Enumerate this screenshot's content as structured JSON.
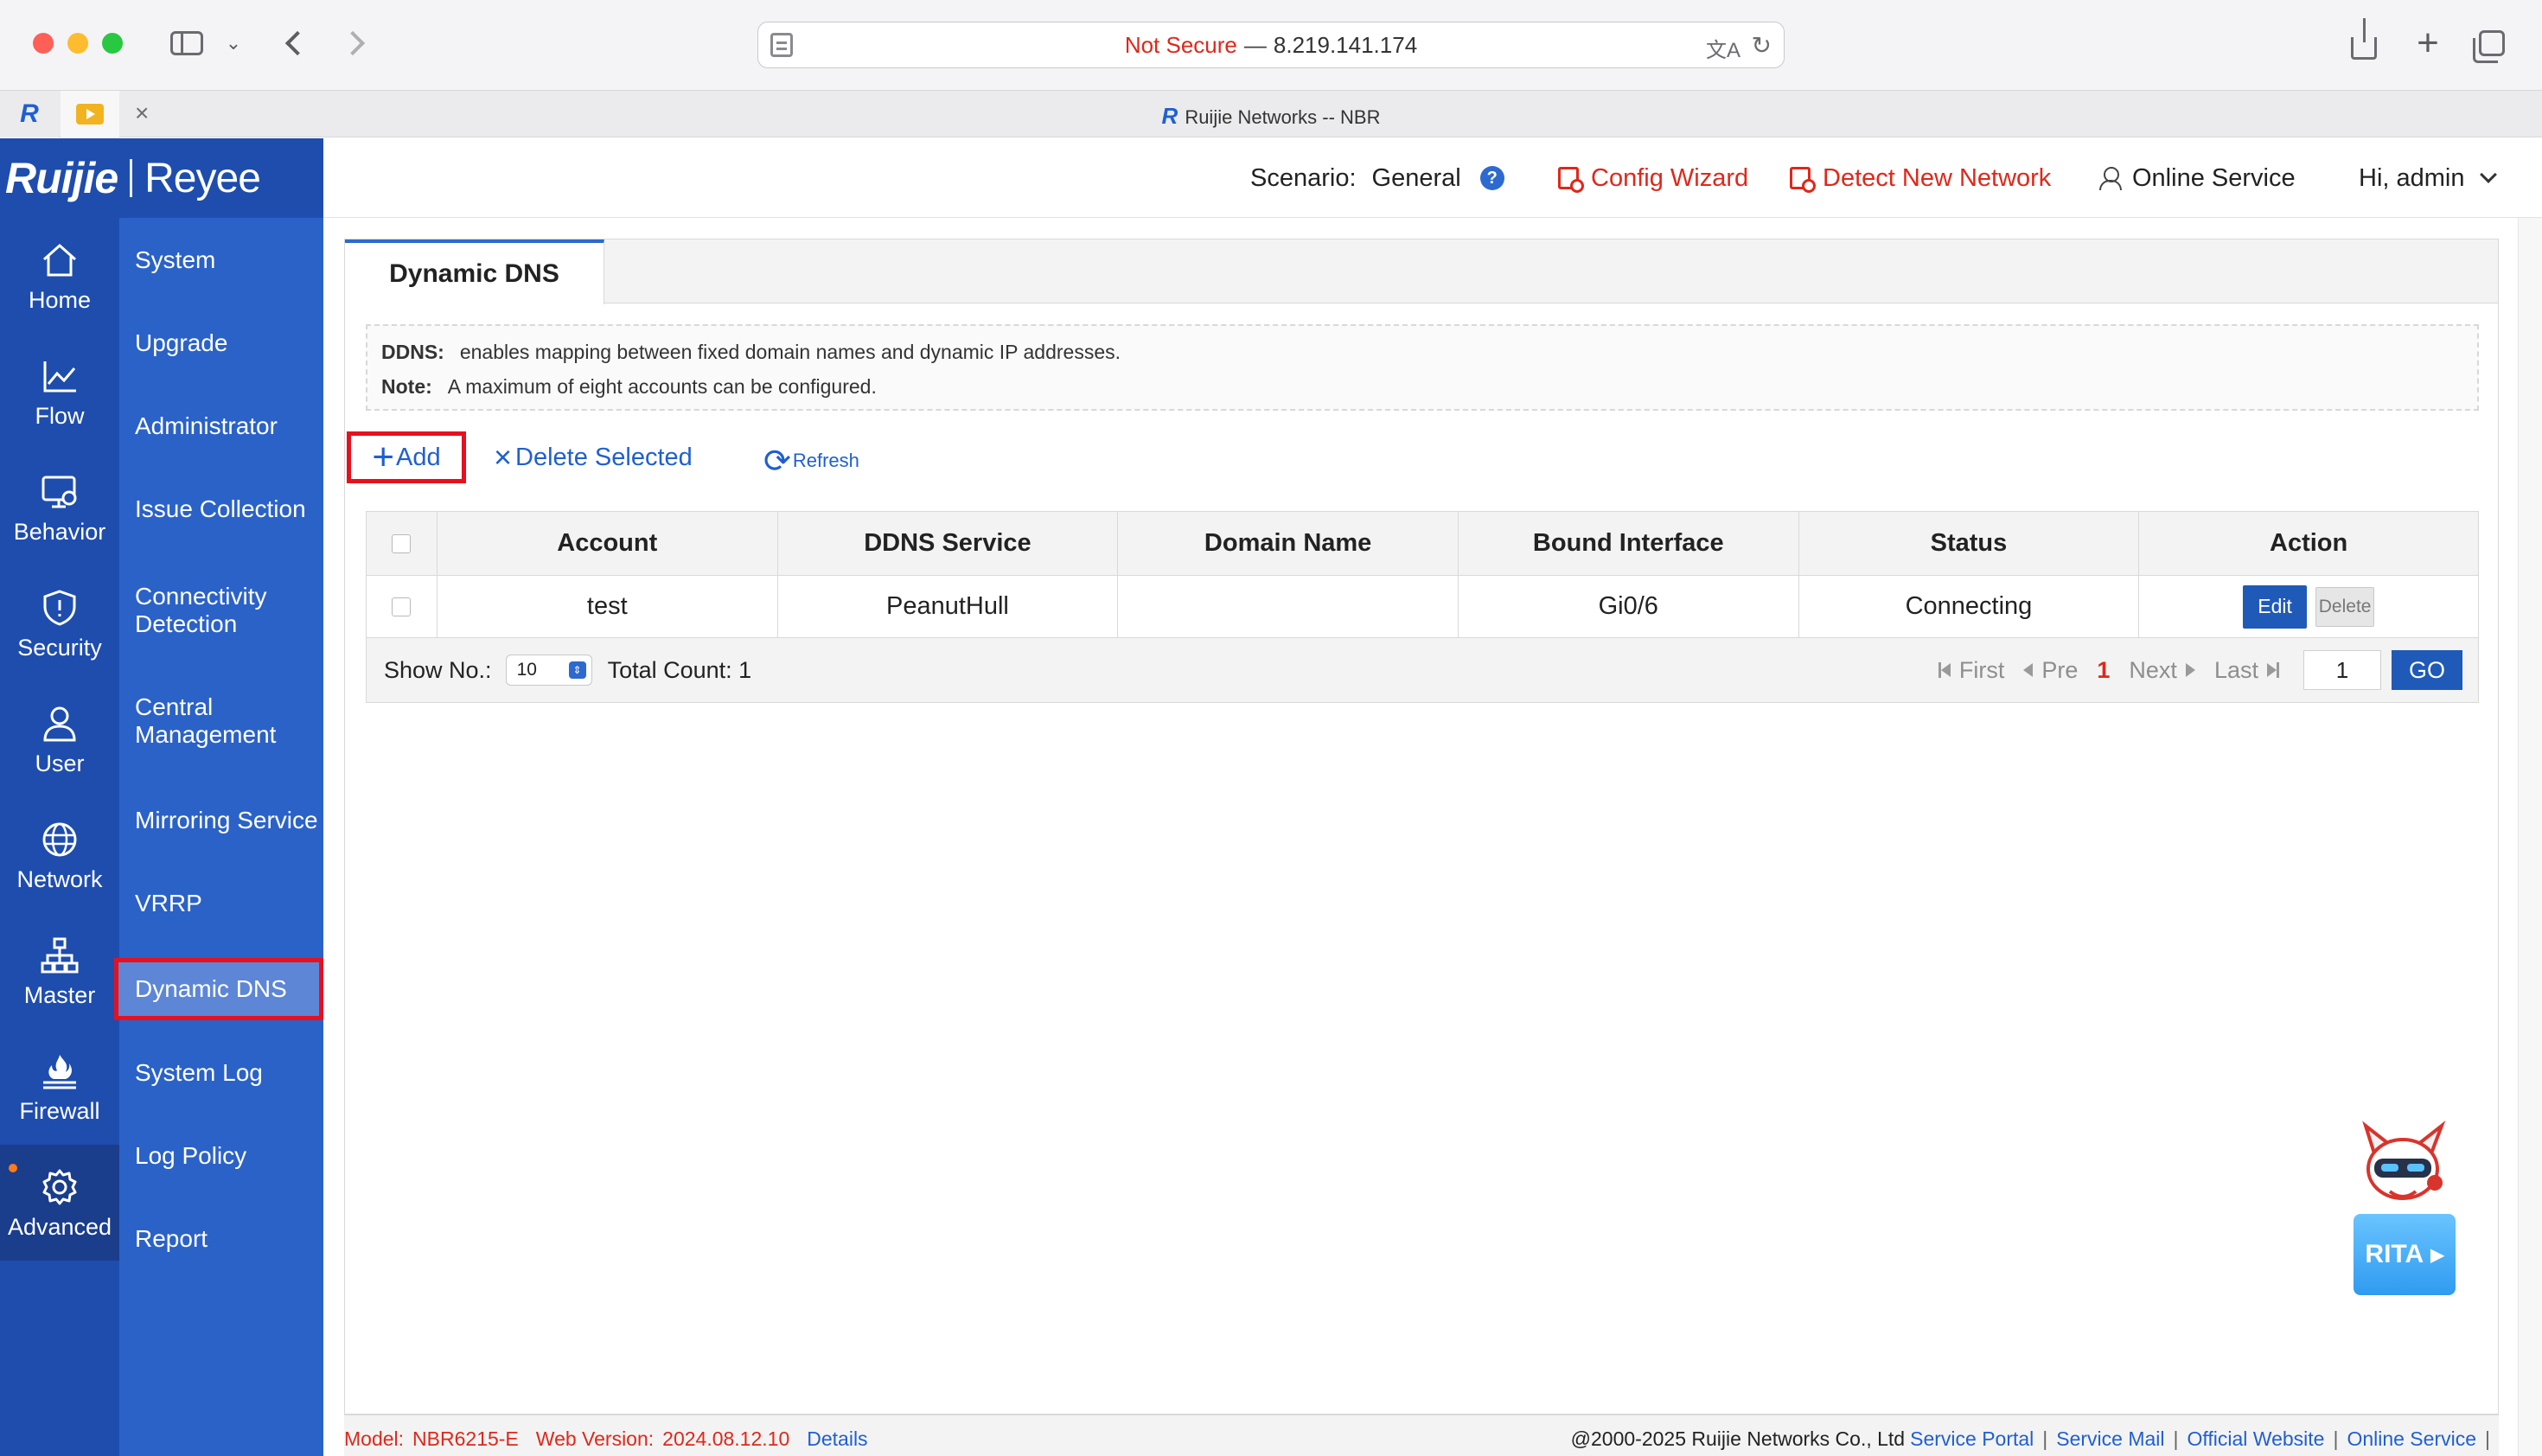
{
  "browser": {
    "url_security": "Not Secure",
    "url_separator": "—",
    "url_host": "8.219.141.174",
    "tab_title": "Ruijie Networks -- NBR",
    "tab_close": "×"
  },
  "brand": {
    "name": "Ruijie",
    "sub": "Reyee"
  },
  "header": {
    "scenario_label": "Scenario:",
    "scenario_value": "General",
    "config_wizard": "Config Wizard",
    "detect_network": "Detect New Network",
    "online_service": "Online Service",
    "user_greeting": "Hi, admin"
  },
  "primary_nav": [
    {
      "label": "Home",
      "icon": "home-icon"
    },
    {
      "label": "Flow",
      "icon": "chart-icon"
    },
    {
      "label": "Behavior",
      "icon": "monitor-icon"
    },
    {
      "label": "Security",
      "icon": "shield-icon"
    },
    {
      "label": "User",
      "icon": "user-icon"
    },
    {
      "label": "Network",
      "icon": "globe-icon"
    },
    {
      "label": "Master",
      "icon": "topology-icon"
    },
    {
      "label": "Firewall",
      "icon": "firewall-icon"
    },
    {
      "label": "Advanced",
      "icon": "gear-icon",
      "active": true
    }
  ],
  "secondary_nav": [
    {
      "label": "System"
    },
    {
      "label": "Upgrade"
    },
    {
      "label": "Administrator"
    },
    {
      "label": "Issue Collection"
    },
    {
      "label": "Connectivity Detection"
    },
    {
      "label": "Central Management"
    },
    {
      "label": "Mirroring Service"
    },
    {
      "label": "VRRP"
    },
    {
      "label": "Dynamic DNS",
      "active": true
    },
    {
      "label": "System Log"
    },
    {
      "label": "Log Policy"
    },
    {
      "label": "Report"
    }
  ],
  "page": {
    "tab": "Dynamic DNS",
    "note_ddns_label": "DDNS:",
    "note_ddns_text": "enables mapping between fixed domain names and dynamic IP addresses.",
    "note_limit_label": "Note:",
    "note_limit_text": "A maximum of eight accounts can be configured.",
    "add": "Add",
    "delete_selected": "Delete Selected",
    "refresh": "Refresh"
  },
  "table": {
    "columns": [
      "Account",
      "DDNS Service",
      "Domain Name",
      "Bound Interface",
      "Status",
      "Action"
    ],
    "rows": [
      {
        "account": "test",
        "service": "PeanutHull",
        "domain": "",
        "interface": "Gi0/6",
        "status": "Connecting",
        "edit": "Edit",
        "delete": "Delete"
      }
    ]
  },
  "pagination": {
    "show_label": "Show No.:",
    "page_size": "10",
    "total": "Total Count: 1",
    "first": "First",
    "pre": "Pre",
    "current": "1",
    "next": "Next",
    "last": "Last",
    "goto_value": "1",
    "go": "GO"
  },
  "assistant": {
    "label": "RITA"
  },
  "footer": {
    "model_label": "Model:",
    "model_value": "NBR6215-E",
    "web_label": "Web Version:",
    "web_value": "2024.08.12.10",
    "details": "Details",
    "copyright": "@2000-2025 Ruijie Networks Co., Ltd",
    "links": [
      "Service Portal",
      "Service Mail",
      "Official Website",
      "Online Service"
    ],
    "sep": "|"
  },
  "colors": {
    "brand_blue": "#1e4dae",
    "secondary_blue": "#2b62c8",
    "accent_red": "#e0271a",
    "link_blue": "#1f5fd2"
  }
}
